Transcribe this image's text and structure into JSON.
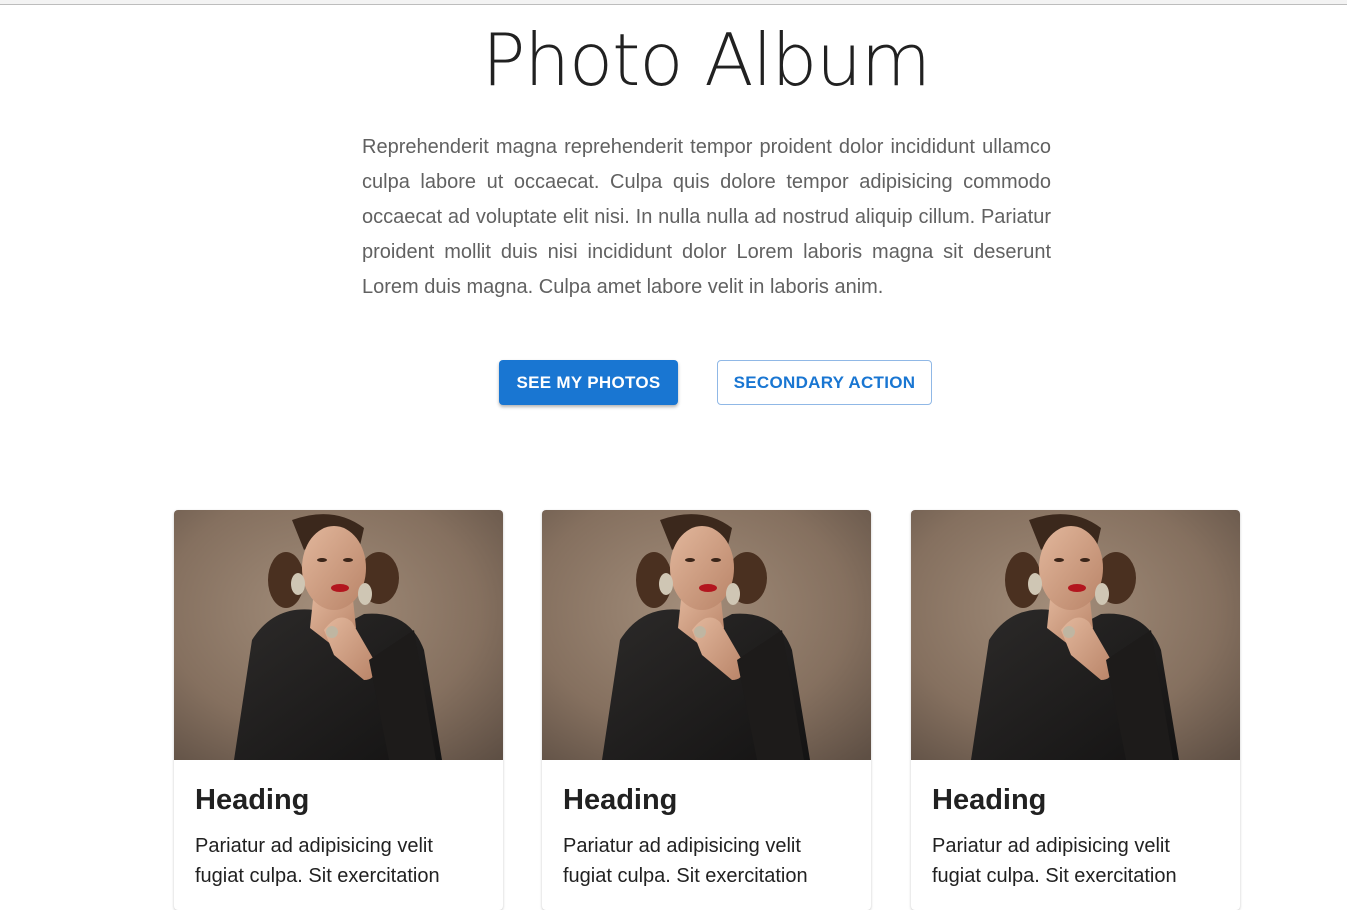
{
  "header": {
    "title": "Photo Album",
    "description": "Reprehenderit magna reprehenderit tempor proident dolor incididunt ullamco culpa labore ut occaecat. Culpa quis dolore tempor adipisicing commodo occaecat ad voluptate elit nisi. In nulla nulla ad nostrud aliquip cillum. Pariatur proident mollit duis nisi incididunt dolor Lorem laboris magna sit deserunt Lorem duis magna. Culpa amet labore velit in laboris anim."
  },
  "actions": {
    "primary_label": "SEE MY PHOTOS",
    "secondary_label": "SECONDARY ACTION"
  },
  "colors": {
    "accent": "#1976d2",
    "text": "#212121",
    "muted": "#616161"
  },
  "cards": [
    {
      "heading": "Heading",
      "text": "Pariatur ad adipisicing velit fugiat culpa. Sit exercitation",
      "image": "portrait-photo"
    },
    {
      "heading": "Heading",
      "text": "Pariatur ad adipisicing velit fugiat culpa. Sit exercitation",
      "image": "portrait-photo"
    },
    {
      "heading": "Heading",
      "text": "Pariatur ad adipisicing velit fugiat culpa. Sit exercitation",
      "image": "portrait-photo"
    }
  ]
}
